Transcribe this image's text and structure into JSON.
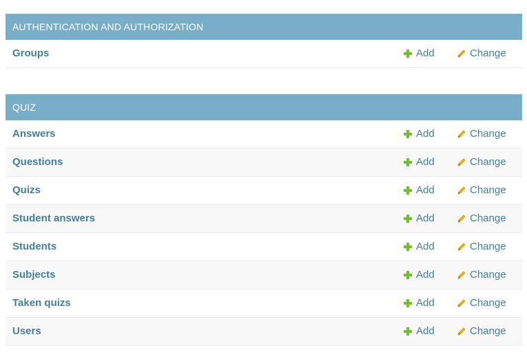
{
  "colors": {
    "header_bg": "#79aec8",
    "link": "#447e9b",
    "add_icon": "#70bf2b",
    "change_icon": "#efb80b"
  },
  "modules": [
    {
      "title": "AUTHENTICATION AND AUTHORIZATION",
      "rows": [
        {
          "name": "Groups",
          "add_label": "Add",
          "change_label": "Change"
        }
      ]
    },
    {
      "title": "QUIZ",
      "rows": [
        {
          "name": "Answers",
          "add_label": "Add",
          "change_label": "Change"
        },
        {
          "name": "Questions",
          "add_label": "Add",
          "change_label": "Change"
        },
        {
          "name": "Quizs",
          "add_label": "Add",
          "change_label": "Change"
        },
        {
          "name": "Student answers",
          "add_label": "Add",
          "change_label": "Change"
        },
        {
          "name": "Students",
          "add_label": "Add",
          "change_label": "Change"
        },
        {
          "name": "Subjects",
          "add_label": "Add",
          "change_label": "Change"
        },
        {
          "name": "Taken quizs",
          "add_label": "Add",
          "change_label": "Change"
        },
        {
          "name": "Users",
          "add_label": "Add",
          "change_label": "Change"
        }
      ]
    }
  ]
}
